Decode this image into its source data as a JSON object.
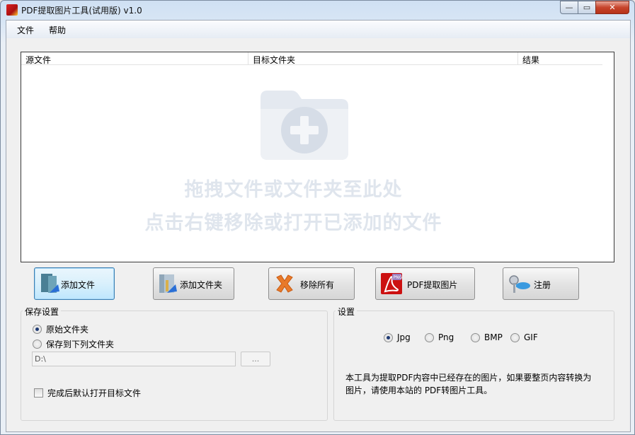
{
  "window": {
    "title": "PDF提取图片工具(试用版) v1.0",
    "controls": {
      "minimize": "—",
      "maximize": "▭",
      "close": "✕"
    }
  },
  "menu": {
    "file": "文件",
    "help": "帮助"
  },
  "file_list": {
    "columns": [
      "源文件",
      "目标文件夹",
      "结果"
    ],
    "drop_hint_1": "拖拽文件或文件夹至此处",
    "drop_hint_2": "点击右键移除或打开已添加的文件"
  },
  "buttons": {
    "add_file": "添加文件",
    "add_folder": "添加文件夹",
    "remove_all": "移除所有",
    "pdf_extract": "PDF提取图片",
    "register": "注册"
  },
  "save_settings": {
    "title": "保存设置",
    "option_original": "原始文件夹",
    "option_custom": "保存到下列文件夹",
    "selected": "原始文件夹",
    "path_value": "D:\\",
    "browse_label": "...",
    "open_after_done": "完成后默认打开目标文件",
    "open_after_done_checked": false
  },
  "settings": {
    "title": "设置",
    "formats": [
      "Jpg",
      "Png",
      "BMP",
      "GIF"
    ],
    "selected_format": "Jpg",
    "description": "本工具为提取PDF内容中已经存在的图片，如果要整页内容转换为图片，请使用本站的 PDF转图片工具。"
  },
  "colors": {
    "focus_border": "#3c7fb1",
    "watermark_text": "#dfe5ed"
  }
}
